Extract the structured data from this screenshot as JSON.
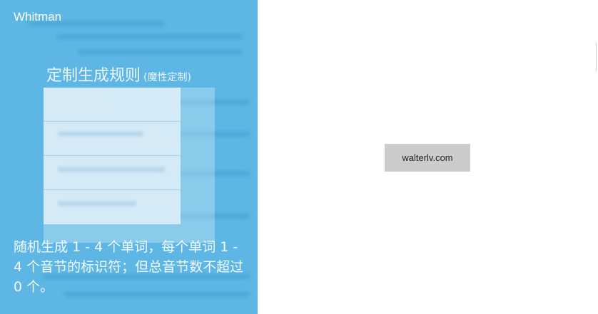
{
  "app": {
    "title": "Whitman"
  },
  "panel": {
    "heading": "定制生成规则",
    "heading_note": "(魔性定制)",
    "description": "随机生成 1 -  4 个单词，每个单词 1 -  4 个音节的标识符；但总音节数不超过 0 个。"
  },
  "site_button": {
    "label": "walterlv.com"
  },
  "colors": {
    "panel_background": "#5db6e3",
    "page_background": "#ffffff",
    "button_background": "#cccccc"
  }
}
